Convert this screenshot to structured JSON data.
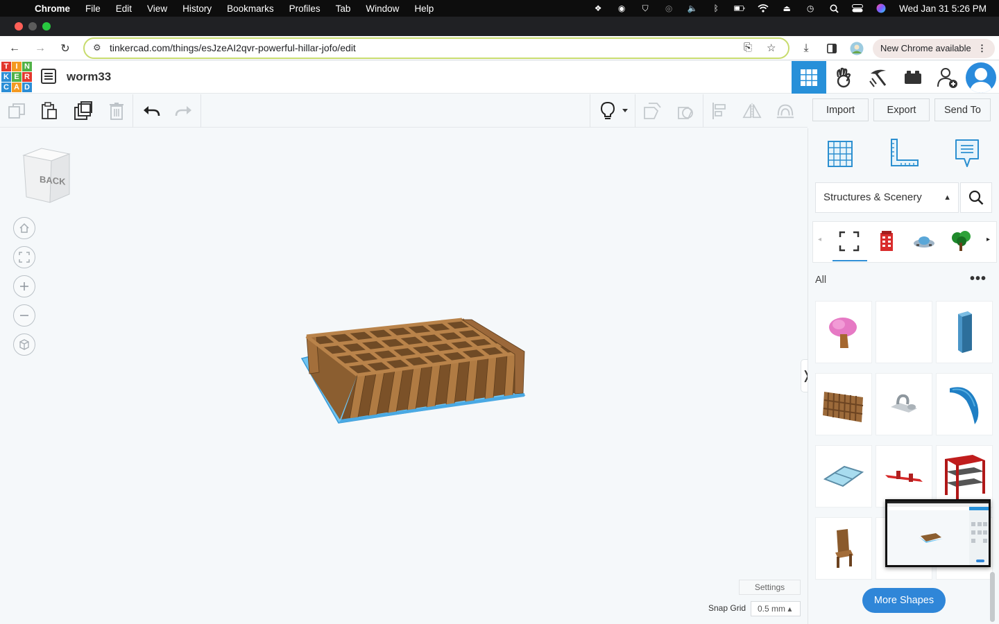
{
  "menubar": {
    "app_name": "Chrome",
    "items": [
      "File",
      "Edit",
      "View",
      "History",
      "Bookmarks",
      "Profiles",
      "Tab",
      "Window",
      "Help"
    ],
    "clock": "Wed Jan 31  5:26 PM"
  },
  "browser": {
    "url": "tinkercad.com/things/esJzeAI2qvr-powerful-hillar-jofo/edit",
    "update_chip": "New Chrome available"
  },
  "header": {
    "logo_letters": [
      "T",
      "I",
      "N",
      "K",
      "E",
      "R",
      "C",
      "A",
      "D"
    ],
    "design_name": "worm33"
  },
  "toolbar": {
    "import_label": "Import",
    "export_label": "Export",
    "send_to_label": "Send To"
  },
  "viewcube": {
    "face_label": "BACK"
  },
  "workplane": {
    "settings_label": "Settings",
    "snap_grid_label": "Snap Grid",
    "snap_grid_value": "0.5 mm ▴"
  },
  "panel": {
    "category": "Structures & Scenery",
    "filter_label": "All",
    "more_shapes_label": "More Shapes"
  },
  "colors": {
    "accent_blue": "#2790d9",
    "workplane_bg": "#f5f8fa",
    "model_brown": "#a0703a",
    "model_base": "#6ec3f0"
  }
}
